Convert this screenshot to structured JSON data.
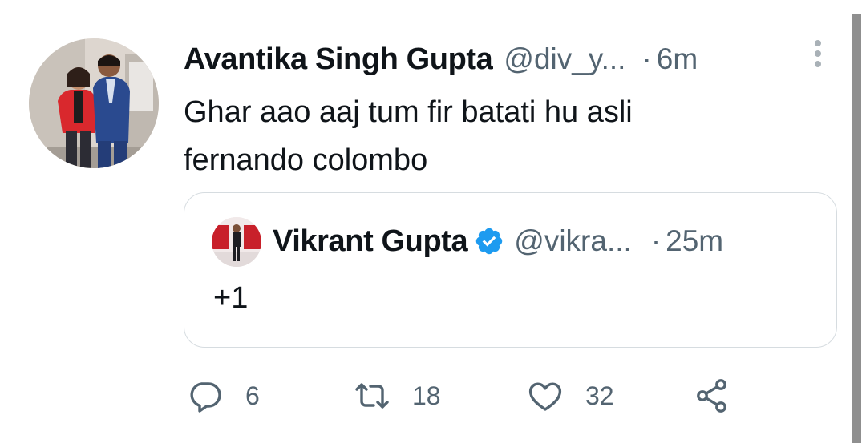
{
  "tweet": {
    "display_name": "Avantika Singh Gupta",
    "handle": "@div_y...",
    "dot": "·",
    "time": "6m",
    "text_line1": "Ghar aao aaj tum fir batati hu asli",
    "text_line2": "fernando colombo"
  },
  "quote": {
    "display_name": "Vikrant Gupta",
    "handle": "@vikra...",
    "dot": "·",
    "time": "25m",
    "text": "+1",
    "verified_color": "#1d9bf0"
  },
  "actions": {
    "reply_count": "6",
    "retweet_count": "18",
    "like_count": "32",
    "icons": [
      "reply-icon",
      "retweet-icon",
      "like-icon",
      "share-icon"
    ]
  },
  "colors": {
    "text_primary": "#0f1419",
    "text_secondary": "#536471",
    "border": "#d6dce0"
  }
}
